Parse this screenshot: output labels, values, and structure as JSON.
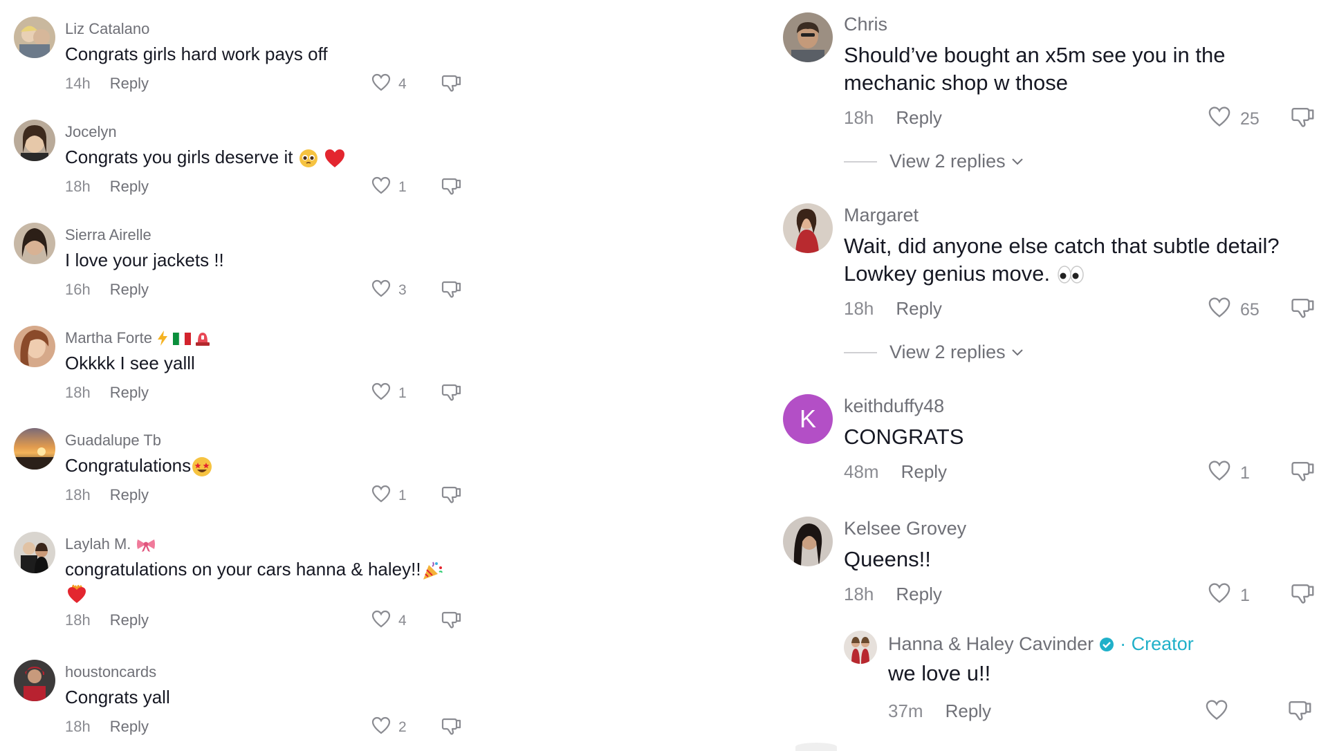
{
  "left": [
    {
      "username": "Liz Catalano",
      "text": "Congrats girls hard work pays off",
      "time": "14h",
      "reply": "Reply",
      "likes": "4"
    },
    {
      "username": "Jocelyn",
      "text": "Congrats you girls deserve it",
      "time": "18h",
      "reply": "Reply",
      "likes": "1"
    },
    {
      "username": "Sierra Airelle",
      "text": "I love your jackets !!",
      "time": "16h",
      "reply": "Reply",
      "likes": "3"
    },
    {
      "username": "Martha Forte",
      "text": "Okkkk I see yalll",
      "time": "18h",
      "reply": "Reply",
      "likes": "1"
    },
    {
      "username": "Guadalupe Tb",
      "text": "Congratulations",
      "time": "18h",
      "reply": "Reply",
      "likes": "1"
    },
    {
      "username": "Laylah M.",
      "text": "congratulations on your cars hanna & haley!!",
      "time": "18h",
      "reply": "Reply",
      "likes": "4"
    },
    {
      "username": "houstoncards",
      "text": "Congrats yall",
      "time": "18h",
      "reply": "Reply",
      "likes": "2"
    }
  ],
  "right": [
    {
      "username": "Chris",
      "text1": "Should’ve bought an x5m see you in the",
      "text2": "mechanic shop w those",
      "time": "18h",
      "reply": "Reply",
      "likes": "25",
      "view_replies": "View 2 replies"
    },
    {
      "username": "Margaret",
      "text1": "Wait, did anyone else catch that subtle detail?",
      "text2": "Lowkey genius move.",
      "time": "18h",
      "reply": "Reply",
      "likes": "65",
      "view_replies": "View 2 replies"
    },
    {
      "username": "keithduffy48",
      "avatar_letter": "K",
      "text1": "CONGRATS",
      "time": "48m",
      "reply": "Reply",
      "likes": "1"
    },
    {
      "username": "Kelsee Grovey",
      "text1": "Queens!!",
      "time": "18h",
      "reply": "Reply",
      "likes": "1"
    }
  ],
  "creator_reply": {
    "username": "Hanna & Haley Cavinder",
    "badge": "· Creator",
    "text": "we love u!!",
    "time": "37m",
    "reply": "Reply"
  },
  "colors": {
    "username": "#6f7077",
    "text": "#161823",
    "meta": "#8a8b91",
    "creator": "#20b0c9",
    "avatar_k": "#b34fc6"
  }
}
